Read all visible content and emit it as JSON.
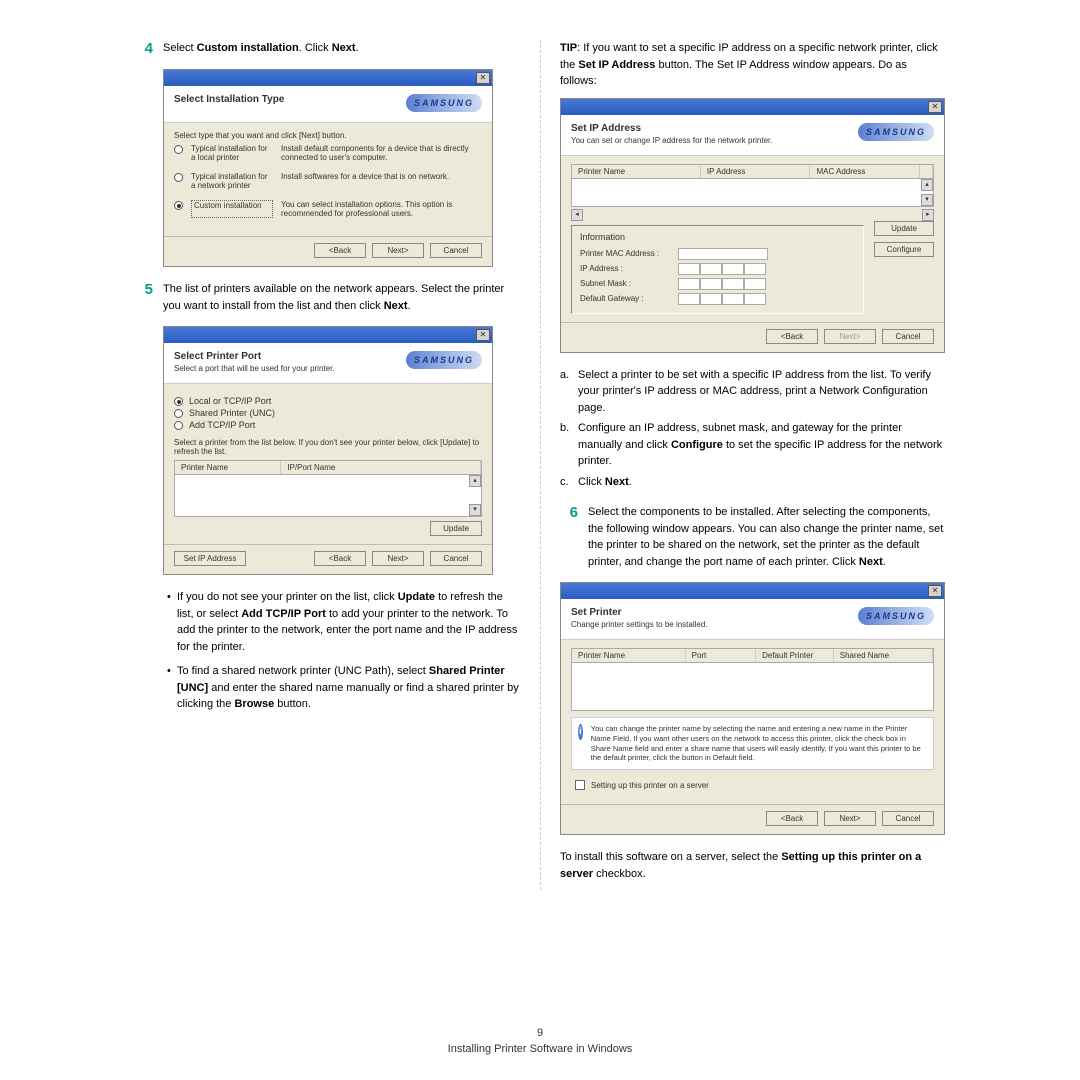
{
  "footer": {
    "page": "9",
    "chapter": "Installing Printer Software in Windows"
  },
  "steps": {
    "s4": {
      "num": "4",
      "pre": "Select ",
      "bold": "Custom installation",
      "post": ". Click ",
      "bold2": "Next",
      "end": "."
    },
    "s5": {
      "num": "5",
      "text": "The list of printers available on the network appears. Select the printer you want to install from the list and then click ",
      "bold": "Next",
      "end": "."
    },
    "s6": {
      "num": "6",
      "text": "Select the components to be installed. After selecting the components, the following window appears. You can also change the printer name, set the printer to be shared on the network, set the printer as the default printer, and change the port name of each printer. Click ",
      "bold": "Next",
      "end": "."
    }
  },
  "tip": {
    "label": "TIP",
    "text": ": If you want to set a specific IP address on a specific network printer, click the ",
    "bold": "Set IP Address",
    "text2": " button. The Set IP Address window appears. Do as follows:"
  },
  "sub": {
    "a": {
      "lbl": "a.",
      "text": "Select a printer to be set with a specific IP address from the list. To verify your printer's IP address or MAC address, print a Network Configuration page."
    },
    "b": {
      "lbl": "b.",
      "text": "Configure an IP address, subnet mask, and gateway for the printer manually and click ",
      "bold": "Configure",
      "text2": " to set the specific IP address for the network printer."
    },
    "c": {
      "lbl": "c.",
      "pre": "Click ",
      "bold": "Next",
      "end": "."
    }
  },
  "bullets": {
    "b1": {
      "pre": "If you do not see your printer on the list, click ",
      "bold1": "Update",
      "mid": " to refresh the list, or select ",
      "bold2": "Add TCP/IP Port",
      "post": " to add your printer to the network. To add the printer to the network, enter the port name and the IP address for the printer."
    },
    "b2": {
      "pre": "To find a shared network printer (UNC Path), select ",
      "bold1": "Shared Printer [UNC]",
      "mid": " and enter the shared name manually or find a shared printer by clicking the ",
      "bold2": "Browse",
      "post": " button."
    }
  },
  "serverline": {
    "pre": "To install this software on a server, select the ",
    "bold": "Setting up this printer on a server",
    "post": " checkbox."
  },
  "brand": "SAMSUNG",
  "close": "✕",
  "dlg1": {
    "title": "Select Installation Type",
    "instr": "Select type that you want and click [Next] button.",
    "opt1_label": "Typical installation for a local printer",
    "opt1_desc": "Install default components for a device that is directly connected to user's computer.",
    "opt2_label": "Typical installation for a network printer",
    "opt2_desc": "Install softwares for a device that is on network.",
    "opt3_label": "Custom installation",
    "opt3_desc": "You can select installation options. This option is recommended for professional users.",
    "back": "<Back",
    "next": "Next>",
    "cancel": "Cancel"
  },
  "dlg2": {
    "title": "Select Printer Port",
    "sub": "Select a port that will be used for your printer.",
    "r1": "Local or TCP/IP Port",
    "r2": "Shared Printer (UNC)",
    "r3": "Add TCP/IP Port",
    "instr": "Select a printer from the list below. If you don't see your printer below, click [Update] to refresh the list.",
    "col1": "Printer Name",
    "col2": "IP/Port Name",
    "update": "Update",
    "setip": "Set IP Address",
    "back": "<Back",
    "next": "Next>",
    "cancel": "Cancel"
  },
  "dlg3": {
    "title": "Set IP Address",
    "sub": "You can set or change IP address for the network printer.",
    "col1": "Printer Name",
    "col2": "IP Address",
    "col3": "MAC Address",
    "info": "Information",
    "f1": "Printer MAC Address :",
    "f2": "IP Address :",
    "f3": "Subnet Mask :",
    "f4": "Default Gateway :",
    "update": "Update",
    "configure": "Configure",
    "back": "<Back",
    "next": "Next>",
    "cancel": "Cancel"
  },
  "dlg4": {
    "title": "Set Printer",
    "sub": "Change printer settings to be installed.",
    "col1": "Printer Name",
    "col2": "Port",
    "col3": "Default Printer",
    "col4": "Shared Name",
    "info": "You can change the printer name by selecting the name and entering a new name in the Printer Name Field. If you want other users on the network to access this printer, click the check box in Share Name field and enter a share name that users will easily identify. If you want this printer to be the default printer, click the button in Default field.",
    "check": "Setting up this printer on a server",
    "back": "<Back",
    "next": "Next>",
    "cancel": "Cancel"
  }
}
